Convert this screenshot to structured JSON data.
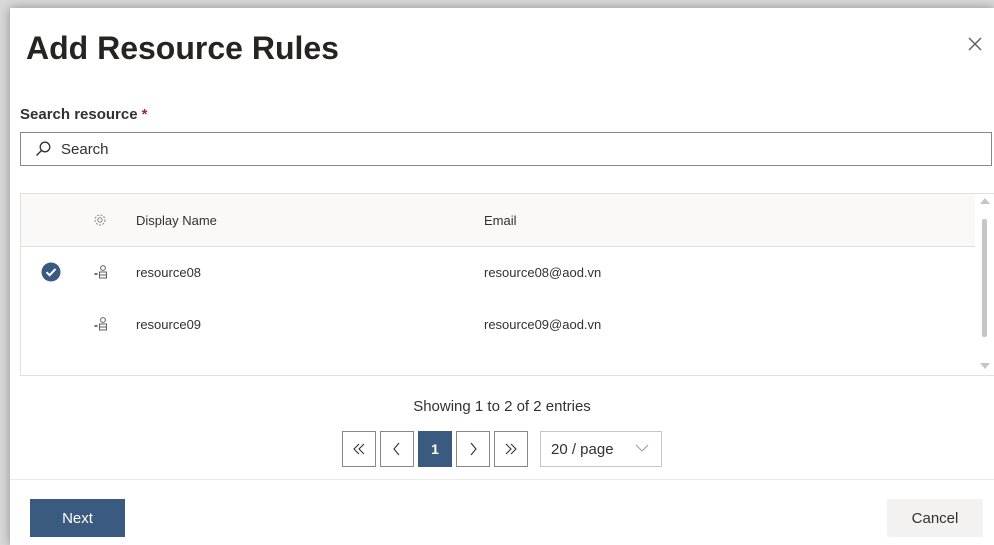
{
  "dialog": {
    "title": "Add Resource Rules",
    "close_icon": "close-icon"
  },
  "search": {
    "label": "Search resource",
    "required_marker": "*",
    "placeholder": "Search",
    "value": "",
    "icon": "search-icon"
  },
  "table": {
    "columns": {
      "settings_icon": "gear-icon",
      "display_name": "Display Name",
      "email": "Email"
    },
    "rows": [
      {
        "selected": true,
        "icon": "resource-icon",
        "display_name": "resource08",
        "email": "resource08@aod.vn"
      },
      {
        "selected": false,
        "icon": "resource-icon",
        "display_name": "resource09",
        "email": "resource09@aod.vn"
      }
    ]
  },
  "pagination": {
    "summary": "Showing 1 to 2 of 2 entries",
    "first_icon": "double-chevron-left-icon",
    "prev_icon": "chevron-left-icon",
    "current_page": "1",
    "next_icon": "chevron-right-icon",
    "last_icon": "double-chevron-right-icon",
    "page_size": "20 / page"
  },
  "footer": {
    "next_label": "Next",
    "cancel_label": "Cancel"
  },
  "colors": {
    "primary": "#3b5a7f",
    "required": "#a4262c"
  }
}
